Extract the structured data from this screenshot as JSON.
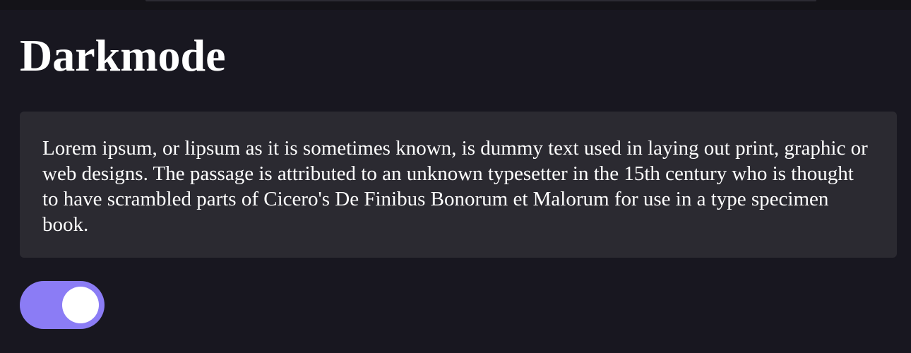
{
  "page": {
    "title": "Darkmode"
  },
  "card": {
    "text": "Lorem ipsum, or lipsum as it is sometimes known, is dummy text used in laying out print, graphic or web designs. The passage is attributed to an unknown typesetter in the 15th century who is thought to have scrambled parts of Cicero's De Finibus Bonorum et Malorum for use in a type specimen book."
  },
  "toggle": {
    "state": "on",
    "color_on": "#8b7cf5",
    "knob_color": "#ffffff"
  },
  "colors": {
    "background": "#181720",
    "card_background": "#2b2a31",
    "text": "#ffffff"
  }
}
